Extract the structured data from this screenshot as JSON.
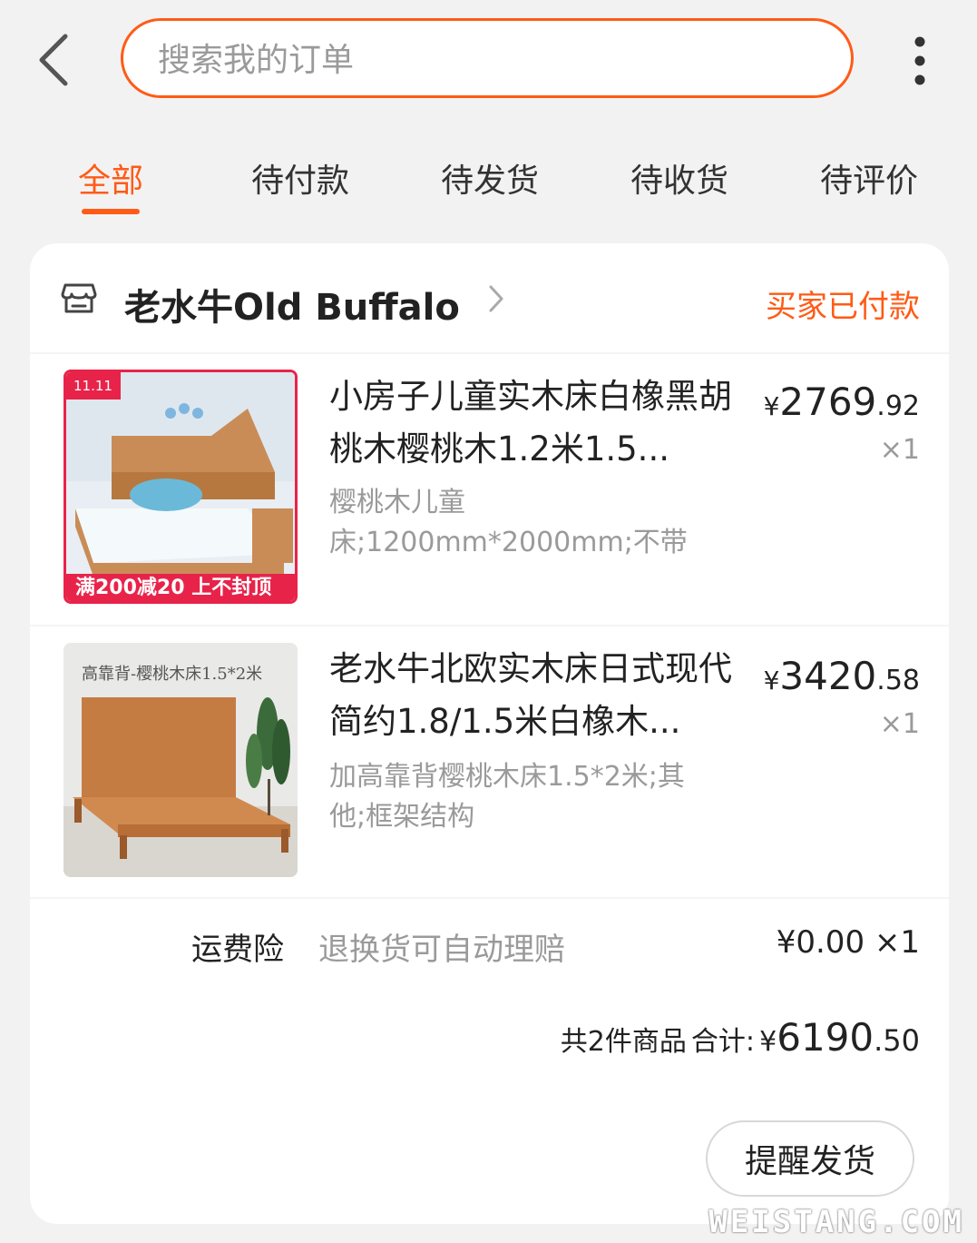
{
  "header": {
    "back_icon": "chevron-left-icon",
    "search_placeholder": "搜索我的订单",
    "more_icon": "vertical-dots-icon"
  },
  "tabs": [
    {
      "label": "全部",
      "active": true
    },
    {
      "label": "待付款",
      "active": false
    },
    {
      "label": "待发货",
      "active": false
    },
    {
      "label": "待收货",
      "active": false
    },
    {
      "label": "待评价",
      "active": false
    }
  ],
  "order": {
    "shop_icon": "store-icon",
    "shop_name": "老水牛Old Buffalo",
    "status": "买家已付款",
    "items": [
      {
        "title": "小房子儿童实木床白橡黑胡桃木樱桃木1.2米1.5...",
        "spec": "樱桃木儿童床;1200mm*2000mm;不带",
        "price_currency": "¥",
        "price_int": "2769",
        "price_dec": ".92",
        "quantity": "×1",
        "thumb_badge": "11.11",
        "thumb_promo": "满200减20 上不封顶"
      },
      {
        "title": "老水牛北欧实木床日式现代简约1.8/1.5米白橡木...",
        "spec": "加高靠背樱桃木床1.5*2米;其他;框架结构",
        "price_currency": "¥",
        "price_int": "3420",
        "price_dec": ".58",
        "quantity": "×1",
        "thumb_caption": "高靠背-樱桃木床1.5*2米"
      }
    ],
    "insurance": {
      "label": "运费险",
      "desc": "退换货可自动理赔",
      "price": "¥0.00 ×1"
    },
    "summary": {
      "count_label": "共2件商品",
      "total_label": "合计:",
      "currency": "¥",
      "total_int": "6190",
      "total_dec": ".50"
    },
    "action_button": "提醒发货"
  },
  "watermark": "WEISTANG.COM",
  "colors": {
    "accent": "#ff5b16",
    "background": "#f2f2f2",
    "muted_text": "#9a9a9a"
  }
}
